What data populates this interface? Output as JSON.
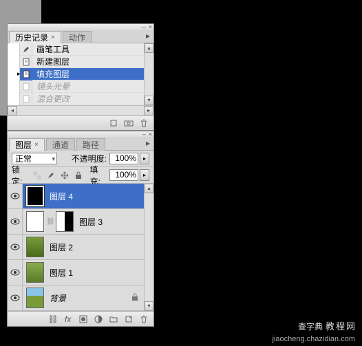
{
  "history_panel": {
    "tabs": [
      {
        "label": "历史记录",
        "active": true
      },
      {
        "label": "动作",
        "active": false
      }
    ],
    "items": [
      {
        "icon": "brush",
        "label": "画笔工具",
        "state": "normal"
      },
      {
        "icon": "doc",
        "label": "新建图层",
        "state": "normal"
      },
      {
        "icon": "doc",
        "label": "填充图层",
        "state": "selected"
      },
      {
        "icon": "doc",
        "label": "镜头光晕",
        "state": "dim"
      },
      {
        "icon": "doc",
        "label": "混合更改",
        "state": "dim"
      }
    ]
  },
  "layers_panel": {
    "tabs": [
      {
        "label": "图层",
        "active": true
      },
      {
        "label": "通道",
        "active": false
      },
      {
        "label": "路径",
        "active": false
      }
    ],
    "blend_mode": "正常",
    "opacity_label": "不透明度:",
    "opacity_value": "100%",
    "lock_label": "锁定:",
    "fill_label": "填充:",
    "fill_value": "100%",
    "layers": [
      {
        "name": "图层 4",
        "thumb": "black",
        "selected": true,
        "visible": true
      },
      {
        "name": "图层 3",
        "thumb": "white",
        "mask": true,
        "selected": false,
        "visible": true
      },
      {
        "name": "图层 2",
        "thumb": "green1",
        "selected": false,
        "visible": true
      },
      {
        "name": "图层 1",
        "thumb": "green2",
        "selected": false,
        "visible": true
      },
      {
        "name": "背景",
        "thumb": "sky",
        "selected": false,
        "visible": true,
        "locked": true,
        "italic": true
      }
    ]
  },
  "watermark": {
    "main": "查字典",
    "sub": "教程网",
    "url": "jiaocheng.chazidian.com"
  }
}
